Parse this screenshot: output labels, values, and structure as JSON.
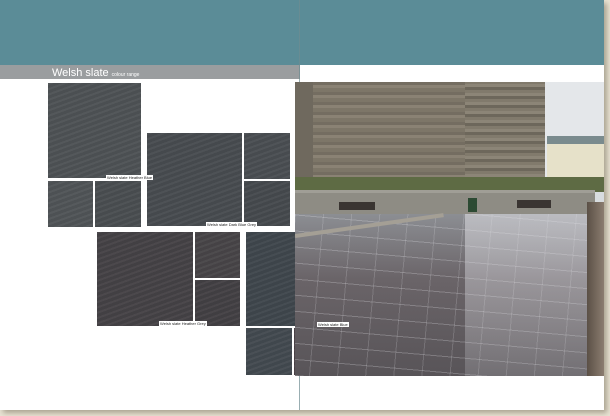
{
  "header": {
    "title": "Welsh slate",
    "subtitle": "colour range"
  },
  "swatches": [
    {
      "label": "Welsh slate Heather Blue"
    },
    {
      "label": "Welsh slate Dark Blue Grey"
    },
    {
      "label": "Welsh slate Heather Grey"
    },
    {
      "label": "Welsh slate Blue"
    }
  ],
  "photo": {
    "icon": "plaza-photo"
  },
  "colors": {
    "header_band": "#5b8c97",
    "title_bar": "#9a9d9f",
    "heather_blue": "#4b4f52",
    "dark_blue_grey": "#494c50",
    "heather_grey": "#454347",
    "blue": "#3f474d"
  }
}
